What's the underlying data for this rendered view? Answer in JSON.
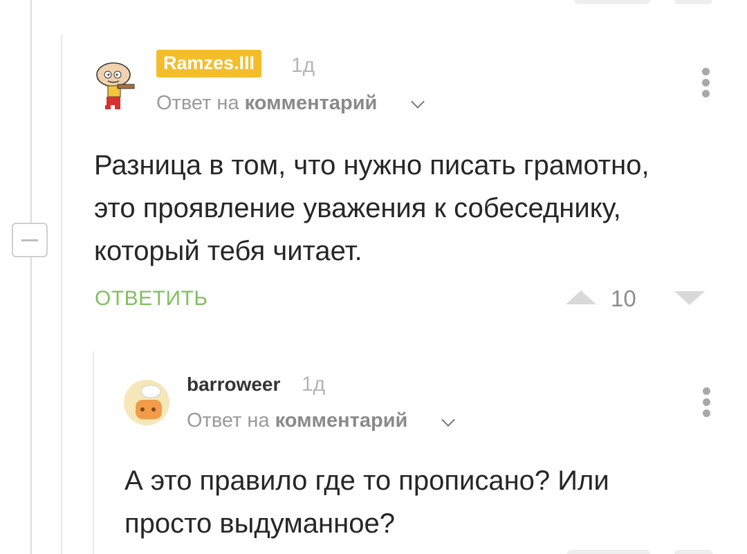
{
  "comment1": {
    "username": "Ramzes.III",
    "time": "1д",
    "reply_prefix": "Ответ на ",
    "reply_link": "комментарий",
    "lines": [
      "Разница в том, что нужно писать грамотно,",
      "это проявление уважения к собеседнику,",
      "который тебя читает."
    ],
    "reply_label": "ОТВЕТИТЬ",
    "score": "10",
    "avatar_icon": "stewie-avatar-icon"
  },
  "comment2": {
    "username": "barroweer",
    "time": "1д",
    "reply_prefix": "Ответ на ",
    "reply_link": "комментарий",
    "lines": [
      "А это правило где то прописано? Или",
      "просто выдуманное?"
    ],
    "avatar_icon": "cook-avatar-icon"
  },
  "colors": {
    "badge": "#f4bd2a",
    "reply_button": "#7fbf5f",
    "thread_line": "#dcdcdc"
  }
}
